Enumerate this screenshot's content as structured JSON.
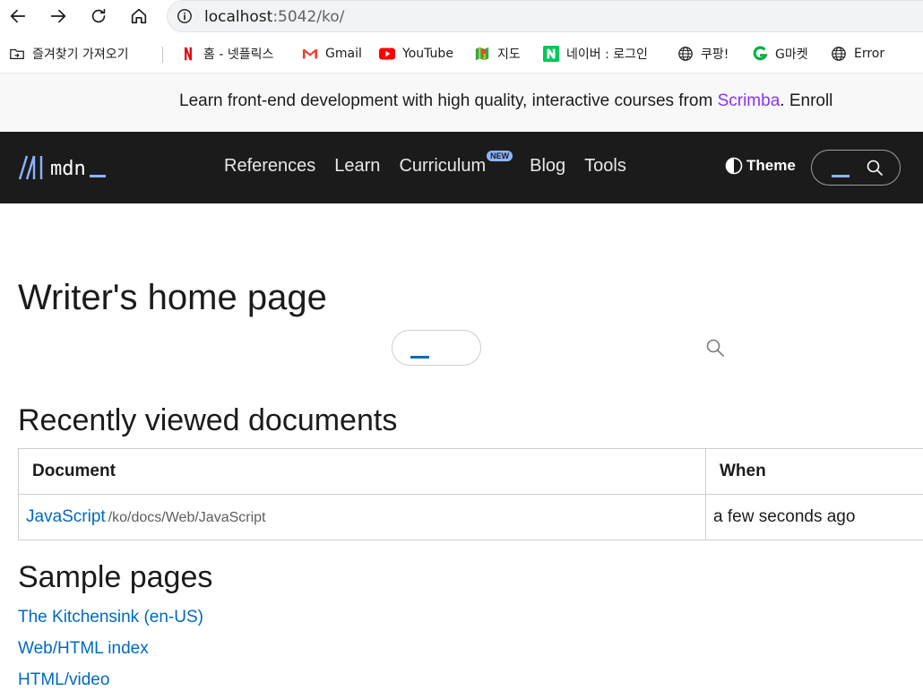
{
  "browser": {
    "url_host": "localhost",
    "url_rest": ":5042/ko/",
    "bookmarks": [
      {
        "label": "즐겨찾기 가져오기",
        "icon": "import-bookmarks-icon"
      },
      {
        "label": "홈 - 넷플릭스",
        "icon": "netflix-icon"
      },
      {
        "label": "Gmail",
        "icon": "gmail-icon"
      },
      {
        "label": "YouTube",
        "icon": "youtube-icon"
      },
      {
        "label": "지도",
        "icon": "maps-icon"
      },
      {
        "label": "네이버 : 로그인",
        "icon": "naver-icon"
      },
      {
        "label": "쿠팡!",
        "icon": "globe-icon"
      },
      {
        "label": "G마켓",
        "icon": "gmarket-icon"
      },
      {
        "label": "Error",
        "icon": "globe-icon"
      }
    ]
  },
  "banner": {
    "text_before": "Learn front-end development with high quality, interactive courses from ",
    "link": "Scrimba",
    "text_after": ". Enroll"
  },
  "header": {
    "logo_text": "mdn",
    "nav": [
      {
        "label": "References"
      },
      {
        "label": "Learn"
      },
      {
        "label": "Curriculum",
        "badge": "NEW"
      },
      {
        "label": "Blog"
      },
      {
        "label": "Tools"
      }
    ],
    "theme_label": "Theme"
  },
  "main": {
    "title": "Writer's home page",
    "recent_heading": "Recently viewed documents",
    "table": {
      "headers": [
        "Document",
        "When"
      ],
      "rows": [
        {
          "title": "JavaScript",
          "path": "/ko/docs/Web/JavaScript",
          "when": "a few seconds ago"
        }
      ]
    },
    "sample_heading": "Sample pages",
    "samples": [
      "The Kitchensink (en-US)",
      "Web/HTML index",
      "HTML/video"
    ]
  },
  "colors": {
    "accent_link": "#0069c2",
    "scrimba": "#8834f5",
    "header_bg": "#1b1b1b",
    "logo_accent": "#8cb4ff"
  }
}
